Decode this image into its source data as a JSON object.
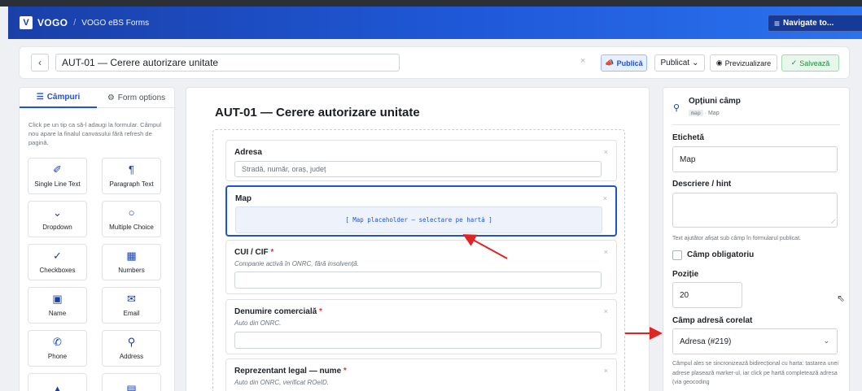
{
  "navbar": {
    "logo": "V",
    "brand": "VOGO",
    "separator": "/",
    "crumb": "VOGO eBS Forms",
    "navigate_label": "Navigate to...",
    "navigate_tail": "v"
  },
  "toolbar": {
    "back_icon": "‹",
    "form_title": "AUT-01 — Cerere autorizare unitate",
    "clear_icon": "×",
    "publish_label": "Publică",
    "status_label": "Publicat",
    "preview_label": "Previzualizare",
    "save_label": "Salvează"
  },
  "left_panel": {
    "tab_fields": "Câmpuri",
    "tab_options": "Form options",
    "hint": "Click pe un tip ca să-l adaugi la formular. Câmpul nou apare la finalul canvasului fără refresh de pagină.",
    "tiles": [
      {
        "icon": "✐",
        "icon_name": "pencil-icon",
        "label": "Single Line Text"
      },
      {
        "icon": "¶",
        "icon_name": "paragraph-icon",
        "label": "Paragraph Text"
      },
      {
        "icon": "⌄",
        "icon_name": "chevron-down-icon",
        "label": "Dropdown"
      },
      {
        "icon": "○",
        "icon_name": "radio-icon",
        "label": "Multiple Choice"
      },
      {
        "icon": "✓",
        "icon_name": "check-icon",
        "label": "Checkboxes"
      },
      {
        "icon": "▦",
        "icon_name": "calculator-icon",
        "label": "Numbers"
      },
      {
        "icon": "▣",
        "icon_name": "id-card-icon",
        "label": "Name"
      },
      {
        "icon": "✉",
        "icon_name": "envelope-icon",
        "label": "Email"
      },
      {
        "icon": "✆",
        "icon_name": "phone-icon",
        "label": "Phone"
      },
      {
        "icon": "⚲",
        "icon_name": "map-pin-icon",
        "label": "Address"
      },
      {
        "icon": "▲",
        "icon_name": "map-icon",
        "label": ""
      },
      {
        "icon": "▤",
        "icon_name": "calendar-icon",
        "label": ""
      }
    ]
  },
  "canvas": {
    "form_title": "AUT-01 — Cerere autorizare unitate",
    "fields": [
      {
        "label": "Adresa",
        "required": "",
        "description": "",
        "placeholder": "Stradă, număr, oraș, județ"
      },
      {
        "label": "Map",
        "required": "",
        "description": "",
        "map_placeholder": "[ Map placeholder — selectare pe hartă ]"
      },
      {
        "label": "CUI / CIF",
        "required": "*",
        "description": "Companie activă în ONRC, fără insolvență.",
        "placeholder": ""
      },
      {
        "label": "Denumire comercială",
        "required": "*",
        "description": "Auto din ONRC.",
        "placeholder": ""
      },
      {
        "label": "Reprezentant legal — nume",
        "required": "*",
        "description": "Auto din ONRC, verificat ROeID.",
        "placeholder": ""
      }
    ],
    "remove_icon": "×"
  },
  "options_panel": {
    "title": "Opțiuni câmp",
    "type_chip": "map",
    "type_name": "· Map",
    "label_label": "Etichetă",
    "label_value": "Map",
    "hint_label": "Descriere / hint",
    "hint_help": "Text ajutător afișat sub câmp în formularul publicat.",
    "required_label": "Câmp obligatoriu",
    "position_label": "Poziție",
    "position_value": "20",
    "linked_label": "Câmp adresă corelat",
    "linked_value": "Adresa (#219)",
    "linked_help": "Câmpul ales se sincronizează bidirecțional cu harta: tastarea unei adrese plasează marker-ul, iar click pe hartă completează adresa (via geocoding"
  },
  "colors": {
    "accent": "#1f53d5",
    "annotation": "#e02424",
    "save_green": "#1e8a3d"
  }
}
